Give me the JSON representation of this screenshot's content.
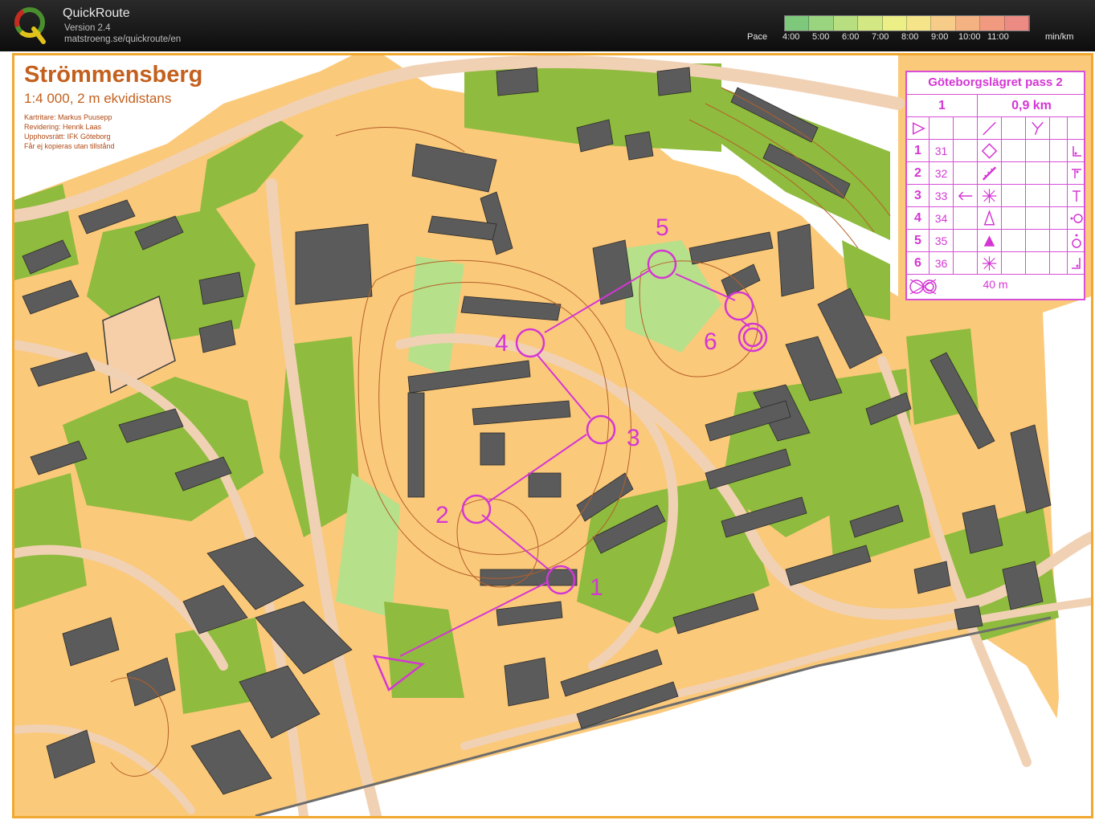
{
  "app": {
    "name": "QuickRoute",
    "version": "Version 2.4",
    "url": "matstroeng.se/quickroute/en"
  },
  "pace": {
    "label": "Pace",
    "ticks": [
      "4:00",
      "5:00",
      "6:00",
      "7:00",
      "8:00",
      "9:00",
      "10:00",
      "11:00"
    ],
    "unit": "min/km",
    "colors": [
      "#7ec87c",
      "#9ad47e",
      "#b7df80",
      "#d3e882",
      "#ecef86",
      "#f5e48a",
      "#f6cc88",
      "#f4b283",
      "#f19a80",
      "#ec8a84"
    ]
  },
  "map": {
    "title": "Strömmensberg",
    "scale": "1:4 000, 2 m ekvidistans",
    "credits": [
      "Kartritare: Markus Puusepp",
      "Revidering: Henrik Laas",
      "Upphovsrätt: IFK Göteborg",
      "Får ej kopieras utan tillstånd"
    ],
    "controls": [
      "1",
      "2",
      "3",
      "4",
      "5",
      "6"
    ],
    "colors": {
      "open": "#fbc97a",
      "forest": "#ffffff",
      "green": "#8fbb3e",
      "building": "#5b5b5b",
      "road": "#f1d1b4",
      "course": "#d436d4",
      "contour": "#b4602a"
    }
  },
  "description": {
    "title": "Göteborgslägret pass 2",
    "course": "1",
    "length": "0,9 km",
    "rows": [
      {
        "num": "1",
        "code": "31",
        "symbol": "diamond-icon",
        "symbol2": "corner-icon"
      },
      {
        "num": "2",
        "code": "32",
        "symbol": "cliff-icon",
        "symbol2": "bend-icon"
      },
      {
        "num": "3",
        "code": "33",
        "symbol": "thicket-icon",
        "symbol2": "foot-icon"
      },
      {
        "num": "4",
        "code": "34",
        "symbol": "boulder-icon",
        "symbol2": "side-icon"
      },
      {
        "num": "5",
        "code": "35",
        "symbol": "triangle-icon",
        "symbol2": "top-icon"
      },
      {
        "num": "6",
        "code": "36",
        "symbol": "thicket-icon",
        "symbol2": "corner2-icon"
      }
    ],
    "finish_distance": "40 m"
  }
}
